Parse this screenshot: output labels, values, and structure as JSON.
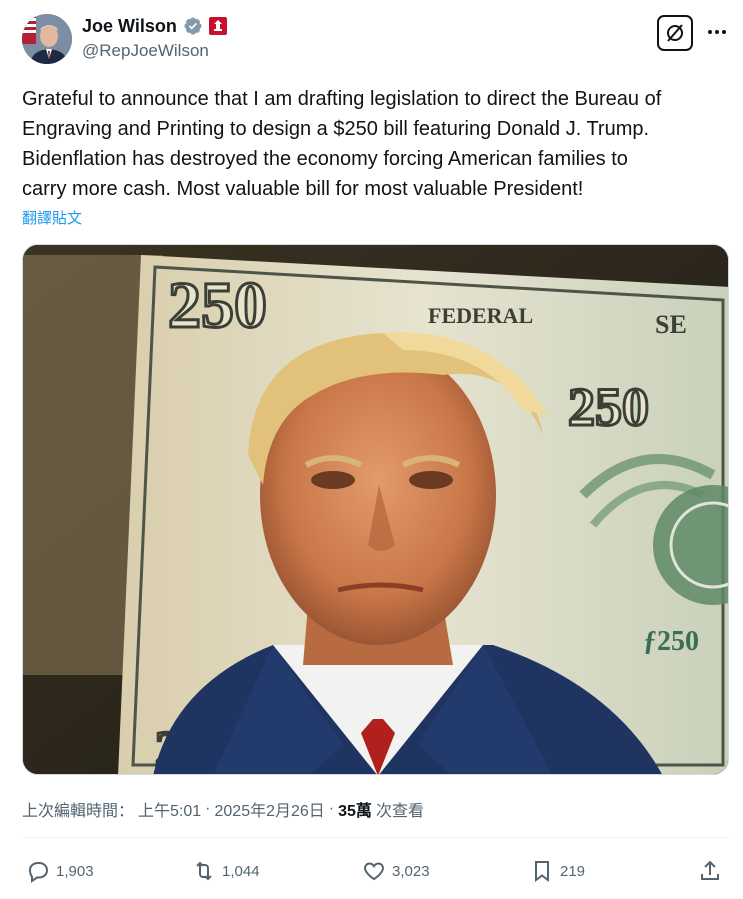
{
  "author": {
    "name": "Joe Wilson",
    "handle": "@RepJoeWilson",
    "verified_icon": "verified-badge-icon",
    "affiliation_icon": "government-badge-icon"
  },
  "tweet": {
    "text": "Grateful to announce that I am drafting legislation to direct the Bureau of\nEngraving and Printing to design a $250 bill featuring Donald J. Trump.\nBidenflation has destroyed the economy forcing American families to\ncarry more cash. Most valuable bill for most valuable President!",
    "translate_label": "翻譯貼文"
  },
  "media": {
    "banknote_denomination": "250",
    "banknote_top_text": "FEDERAL",
    "banknote_right_text": "SE"
  },
  "meta": {
    "edited_label": "上次編輯時間：",
    "time": "上午5:01",
    "date": "2025年2月26日",
    "separator": "·",
    "views_count": "35萬",
    "views_label": "次查看"
  },
  "actions": {
    "replies": "1,903",
    "reposts": "1,044",
    "likes": "3,023",
    "bookmarks": "219"
  },
  "colors": {
    "link": "#1d9bf0",
    "secondary_text": "#536471",
    "verified": "#829aab",
    "gov_badge": "#c8102e"
  }
}
